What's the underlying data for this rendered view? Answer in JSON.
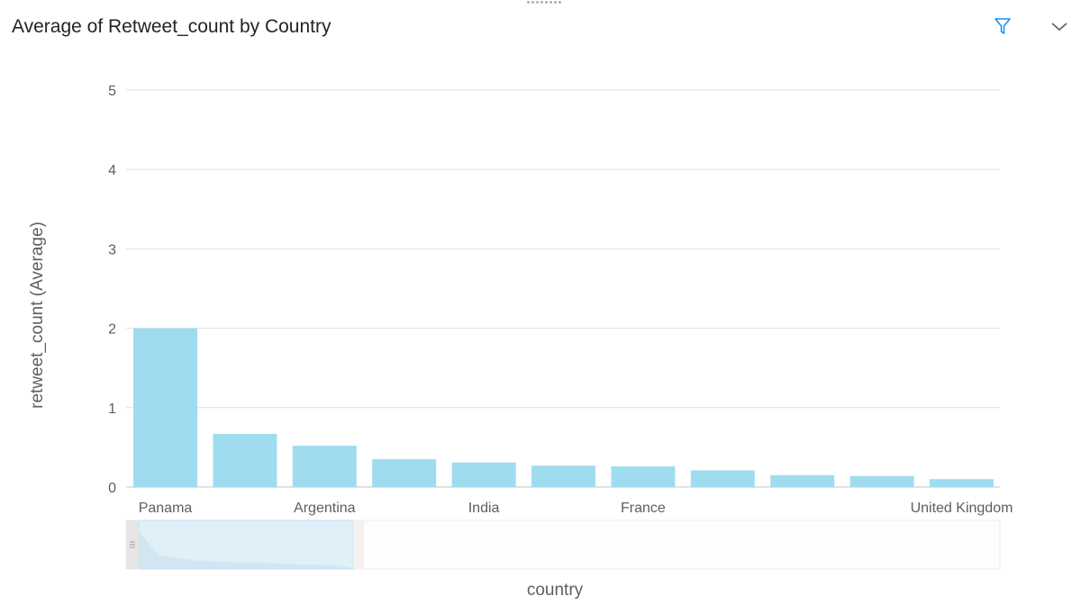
{
  "header": {
    "title": "Average of Retweet_count by Country",
    "filter_icon": "filter-icon",
    "expand_icon": "chevron-down-icon"
  },
  "colors": {
    "bar": "#a0dcf0",
    "grid": "#e1dfdd",
    "text": "#605e5c",
    "icon_accent": "#118dff"
  },
  "chart_data": {
    "type": "bar",
    "xlabel": "country",
    "ylabel": "retweet_count (Average)",
    "ylim": [
      0,
      5
    ],
    "yticks": [
      0,
      1,
      2,
      3,
      4,
      5
    ],
    "grid": true,
    "categories": [
      "Panama",
      "",
      "Argentina",
      "",
      "India",
      "",
      "France",
      "",
      "",
      "",
      "United Kingdom"
    ],
    "values": [
      2.0,
      0.67,
      0.52,
      0.35,
      0.31,
      0.27,
      0.26,
      0.21,
      0.15,
      0.14,
      0.1
    ]
  },
  "scrollbar": {
    "visible_fraction_start": 0.0,
    "visible_fraction_end": 0.26
  }
}
